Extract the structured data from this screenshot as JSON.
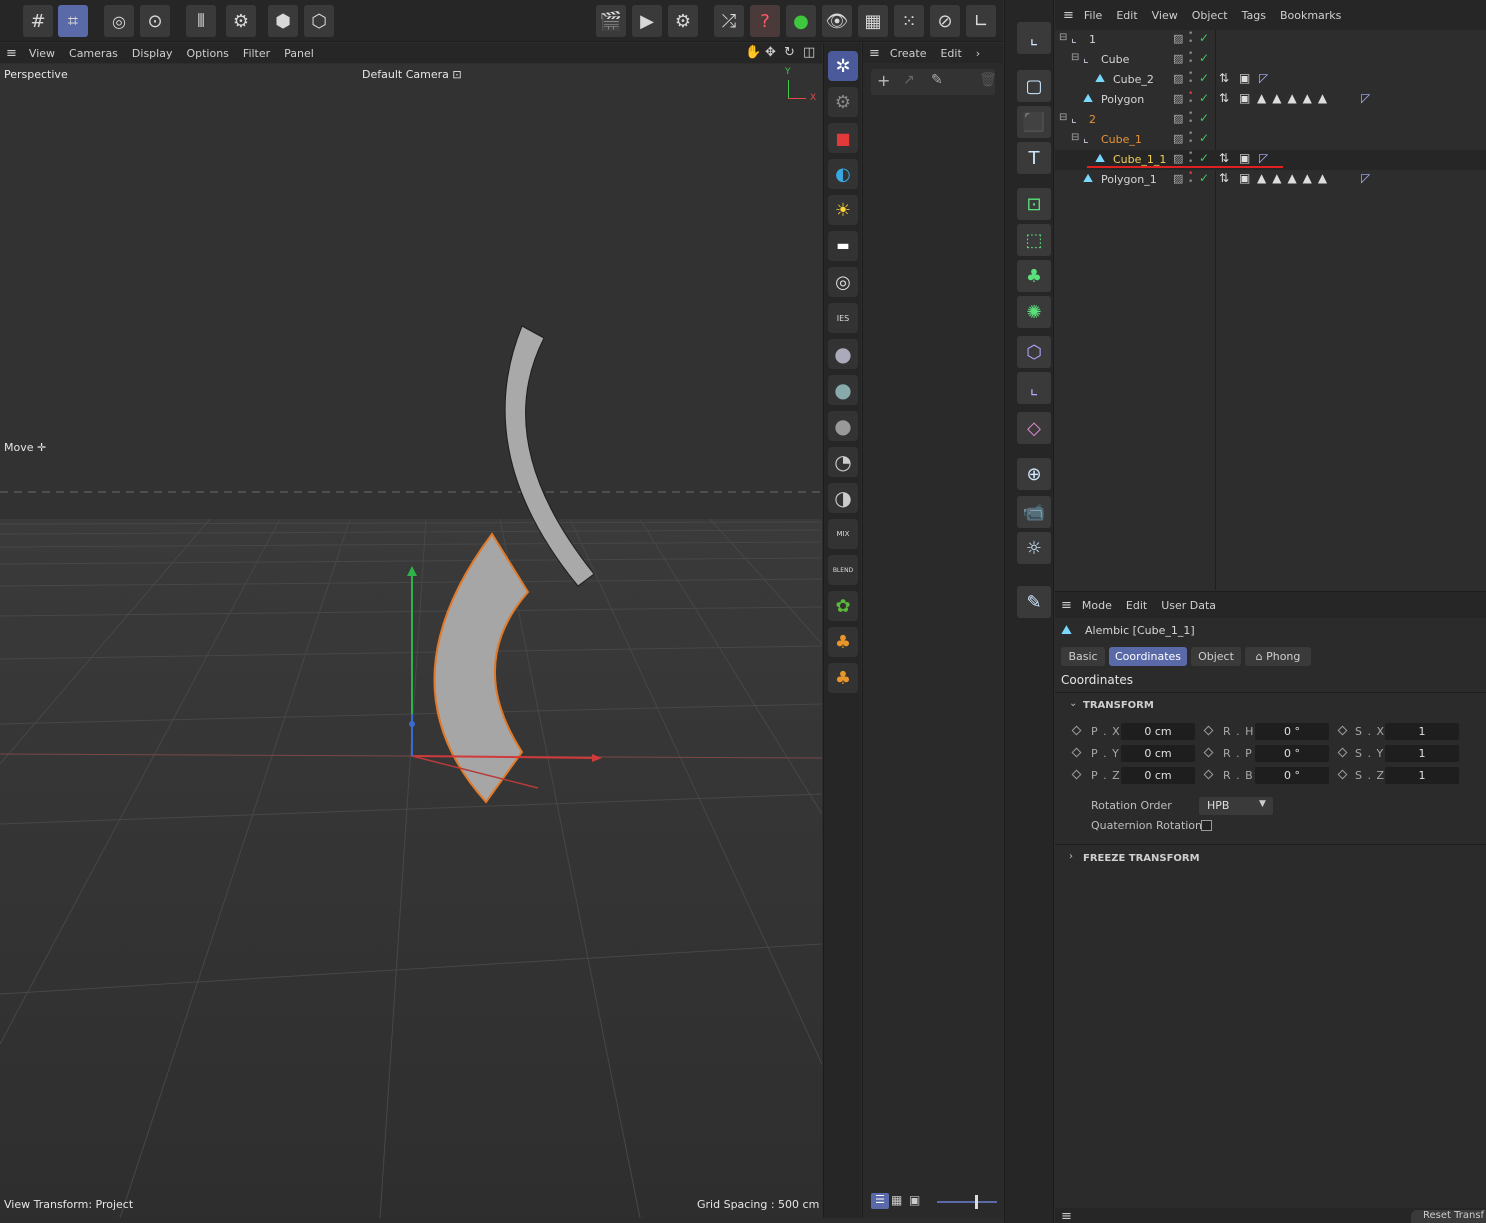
{
  "viewport": {
    "menu": [
      "View",
      "Cameras",
      "Display",
      "Options",
      "Filter",
      "Panel"
    ],
    "projection": "Perspective",
    "camera": "Default Camera",
    "camera_suffix": "⊡",
    "tool": "Move ✛",
    "view_transform": "View Transform: Project",
    "grid_spacing": "Grid Spacing : 500 cm",
    "axis_y": "Y",
    "axis_x": "X"
  },
  "create_panel": {
    "menu": [
      "Create",
      "Edit"
    ],
    "more": "›"
  },
  "object_manager": {
    "menu": [
      "File",
      "Edit",
      "View",
      "Object",
      "Tags",
      "Bookmarks"
    ],
    "items": [
      {
        "name": "1",
        "level": 0
      },
      {
        "name": "Cube",
        "level": 1
      },
      {
        "name": "Cube_2",
        "level": 2
      },
      {
        "name": "Polygon",
        "level": 1
      },
      {
        "name": "2",
        "level": 0
      },
      {
        "name": "Cube_1",
        "level": 1
      },
      {
        "name": "Cube_1_1",
        "level": 2
      },
      {
        "name": "Polygon_1",
        "level": 1
      }
    ]
  },
  "attributes": {
    "menu": [
      "Mode",
      "Edit",
      "User Data"
    ],
    "object_title": "Alembic [Cube_1_1]",
    "tabs": [
      "Basic",
      "Coordinates",
      "Object",
      "⌂ Phong"
    ],
    "active_tab": "Coordinates",
    "section_title": "Coordinates",
    "transform_label": "TRANSFORM",
    "freeze_label": "FREEZE TRANSFORM",
    "rows": [
      {
        "p_label": "P . X",
        "p_val": "0 cm",
        "r_label": "R . H",
        "r_val": "0 °",
        "s_label": "S . X",
        "s_val": "1"
      },
      {
        "p_label": "P . Y",
        "p_val": "0 cm",
        "r_label": "R . P",
        "r_val": "0 °",
        "s_label": "S . Y",
        "s_val": "1"
      },
      {
        "p_label": "P . Z",
        "p_val": "0 cm",
        "r_label": "R . B",
        "r_val": "0 °",
        "s_label": "S . Z",
        "s_val": "1"
      }
    ],
    "rotation_order_label": "Rotation Order",
    "rotation_order_value": "HPB",
    "quaternion_label": "Quaternion Rotation",
    "reset_label": "Reset Transf"
  },
  "colors": {
    "accent": "#5a6aa8",
    "selected_orange": "#e6943a",
    "selected_yellow": "#f0d25a",
    "check_green": "#3ec85a",
    "annotation_red": "#e02020"
  }
}
